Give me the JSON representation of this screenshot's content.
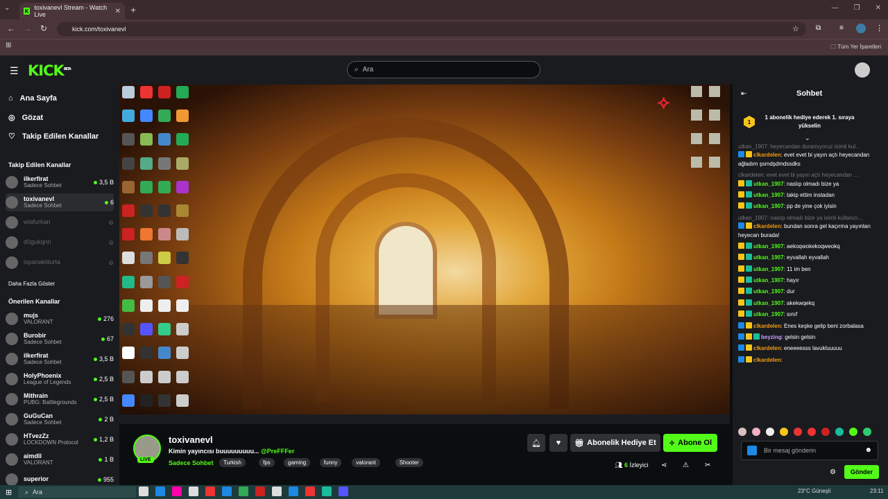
{
  "browser": {
    "tab_title": "toxivanevl Stream - Watch Live",
    "url": "kick.com/toxivanevl",
    "bookmarks_label": "Tüm Yer İşaretleri"
  },
  "header": {
    "logo": "KICK",
    "logo_beta": "BETA",
    "search_placeholder": "Ara"
  },
  "sidebar": {
    "nav": [
      {
        "label": "Ana Sayfa",
        "icon": "home-icon"
      },
      {
        "label": "Gözat",
        "icon": "compass-icon"
      },
      {
        "label": "Takip Edilen Kanallar",
        "icon": "heart-icon"
      }
    ],
    "followed_title": "Takip Edilen Kanallar",
    "followed": [
      {
        "name": "ilkerfirat",
        "sub": "Sadece Sohbet",
        "count": "3,5 B",
        "live": true
      },
      {
        "name": "toxivanevl",
        "sub": "Sadece Sohbet",
        "count": "6",
        "live": true
      },
      {
        "name": "wiafurkan",
        "sub": "",
        "count": "",
        "live": false
      },
      {
        "name": "d0gukqnn",
        "sub": "",
        "count": "",
        "live": false
      },
      {
        "name": "ispanakliturta",
        "sub": "",
        "count": "",
        "live": false
      }
    ],
    "show_more": "Daha Fazla Göster",
    "recommended_title": "Önerilen Kanallar",
    "recommended": [
      {
        "name": "mujs",
        "sub": "VALORANT",
        "count": "276"
      },
      {
        "name": "Burobir",
        "sub": "Sadece Sohbet",
        "count": "67"
      },
      {
        "name": "ilkerfirat",
        "sub": "Sadece Sohbet",
        "count": "3,5 B"
      },
      {
        "name": "HolyPhoenix",
        "sub": "League of Legends",
        "count": "2,5 B"
      },
      {
        "name": "Mithrain",
        "sub": "PUBG: Battlegrounds",
        "count": "2,5 B"
      },
      {
        "name": "GuGuCan",
        "sub": "Sadece Sohbet",
        "count": "2 B"
      },
      {
        "name": "HTvezZz",
        "sub": "LOCKDOWN Protocol",
        "count": "1,2 B"
      },
      {
        "name": "aimdll",
        "sub": "VALORANT",
        "count": "1 B"
      },
      {
        "name": "superior",
        "sub": "",
        "count": "955"
      }
    ]
  },
  "stream": {
    "live_badge": "LIVE",
    "name": "toxivanevl",
    "title": "Kimin yayıncısı buuuuuuuuu...",
    "mention": "@PreFFFer",
    "category": "Sadece Sohbet",
    "tags": [
      "Turkish",
      "fps",
      "gaming",
      "funny",
      "valorant",
      "Shooter"
    ],
    "gift_label": "Abonelik Hediye Et",
    "subscribe_label": "Abone Ol",
    "viewers_count": "6",
    "viewers_label": "İzleyici"
  },
  "chat": {
    "title": "Sohbet",
    "pinned": "1 abonelik hediye ederek 1. sıraya yükselin",
    "pinned_rank": "1",
    "messages": [
      {
        "type": "reply",
        "text": "utkan_1907: heyecandan duramıyoruz isimli kul..."
      },
      {
        "user": "clkardelen",
        "color": "#f39c12",
        "badges": [
          "b",
          "g"
        ],
        "text": "evet evet bi yayın açtı heyecandan ağladım şsmdşdmdssdks"
      },
      {
        "type": "reply",
        "text": "clkardelen: evet evet bi yayın açtı heyecandan ..."
      },
      {
        "user": "utkan_1907",
        "color": "#53fc18",
        "badges": [
          "g",
          "t"
        ],
        "text": "naslıp olmadı bize ya"
      },
      {
        "user": "utkan_1907",
        "color": "#53fc18",
        "badges": [
          "g",
          "t"
        ],
        "text": "takip ettim instadan"
      },
      {
        "user": "utkan_1907",
        "color": "#53fc18",
        "badges": [
          "g",
          "t"
        ],
        "text": "pp de yine çok iyisin"
      },
      {
        "type": "reply",
        "text": "utkan_1907: naslıp olmadı bize ya isimli kullanıcı..."
      },
      {
        "user": "clkardelen",
        "color": "#f39c12",
        "badges": [
          "b",
          "g"
        ],
        "text": "bundan sonra gel kaçırma yayınları heyecan burada!"
      },
      {
        "user": "utkan_1907",
        "color": "#53fc18",
        "badges": [
          "g",
          "t"
        ],
        "text": "aekoqwokekoqweokq"
      },
      {
        "user": "utkan_1907",
        "color": "#53fc18",
        "badges": [
          "g",
          "t"
        ],
        "text": "eyvallah eyvallah"
      },
      {
        "user": "utkan_1907",
        "color": "#53fc18",
        "badges": [
          "g",
          "t"
        ],
        "text": "11 im ben"
      },
      {
        "user": "utkan_1907",
        "color": "#53fc18",
        "badges": [
          "g",
          "t"
        ],
        "text": "hayır"
      },
      {
        "user": "utkan_1907",
        "color": "#53fc18",
        "badges": [
          "g",
          "t"
        ],
        "text": "dur"
      },
      {
        "user": "utkan_1907",
        "color": "#53fc18",
        "badges": [
          "g",
          "t"
        ],
        "text": "akekwqekq"
      },
      {
        "user": "utkan_1907",
        "color": "#53fc18",
        "badges": [
          "g",
          "t"
        ],
        "text": "sınıf"
      },
      {
        "user": "clkardelen",
        "color": "#f39c12",
        "badges": [
          "b",
          "g"
        ],
        "text": "Enes keşke gelip beni zorbalasa"
      },
      {
        "user": "beyzing",
        "color": "#c9a0ff",
        "badges": [
          "b",
          "g",
          "t"
        ],
        "text": "gelsin gelsin"
      },
      {
        "user": "clkardelen",
        "color": "#f39c12",
        "badges": [
          "b",
          "g"
        ],
        "text": "eneeeesss lavukluuuuu"
      },
      {
        "user": "clkardelen",
        "color": "#f39c12",
        "badges": [
          "b",
          "g"
        ],
        "text": ""
      }
    ],
    "input_placeholder": "Bir mesaj gönderin",
    "send_label": "Gönder"
  },
  "os": {
    "search_placeholder": "Ara",
    "weather": "23°C  Güneşli",
    "time": "23:11"
  },
  "colors": {
    "accent": "#53fc18",
    "bg": "#0b0e0f",
    "panel": "#191b1f"
  }
}
